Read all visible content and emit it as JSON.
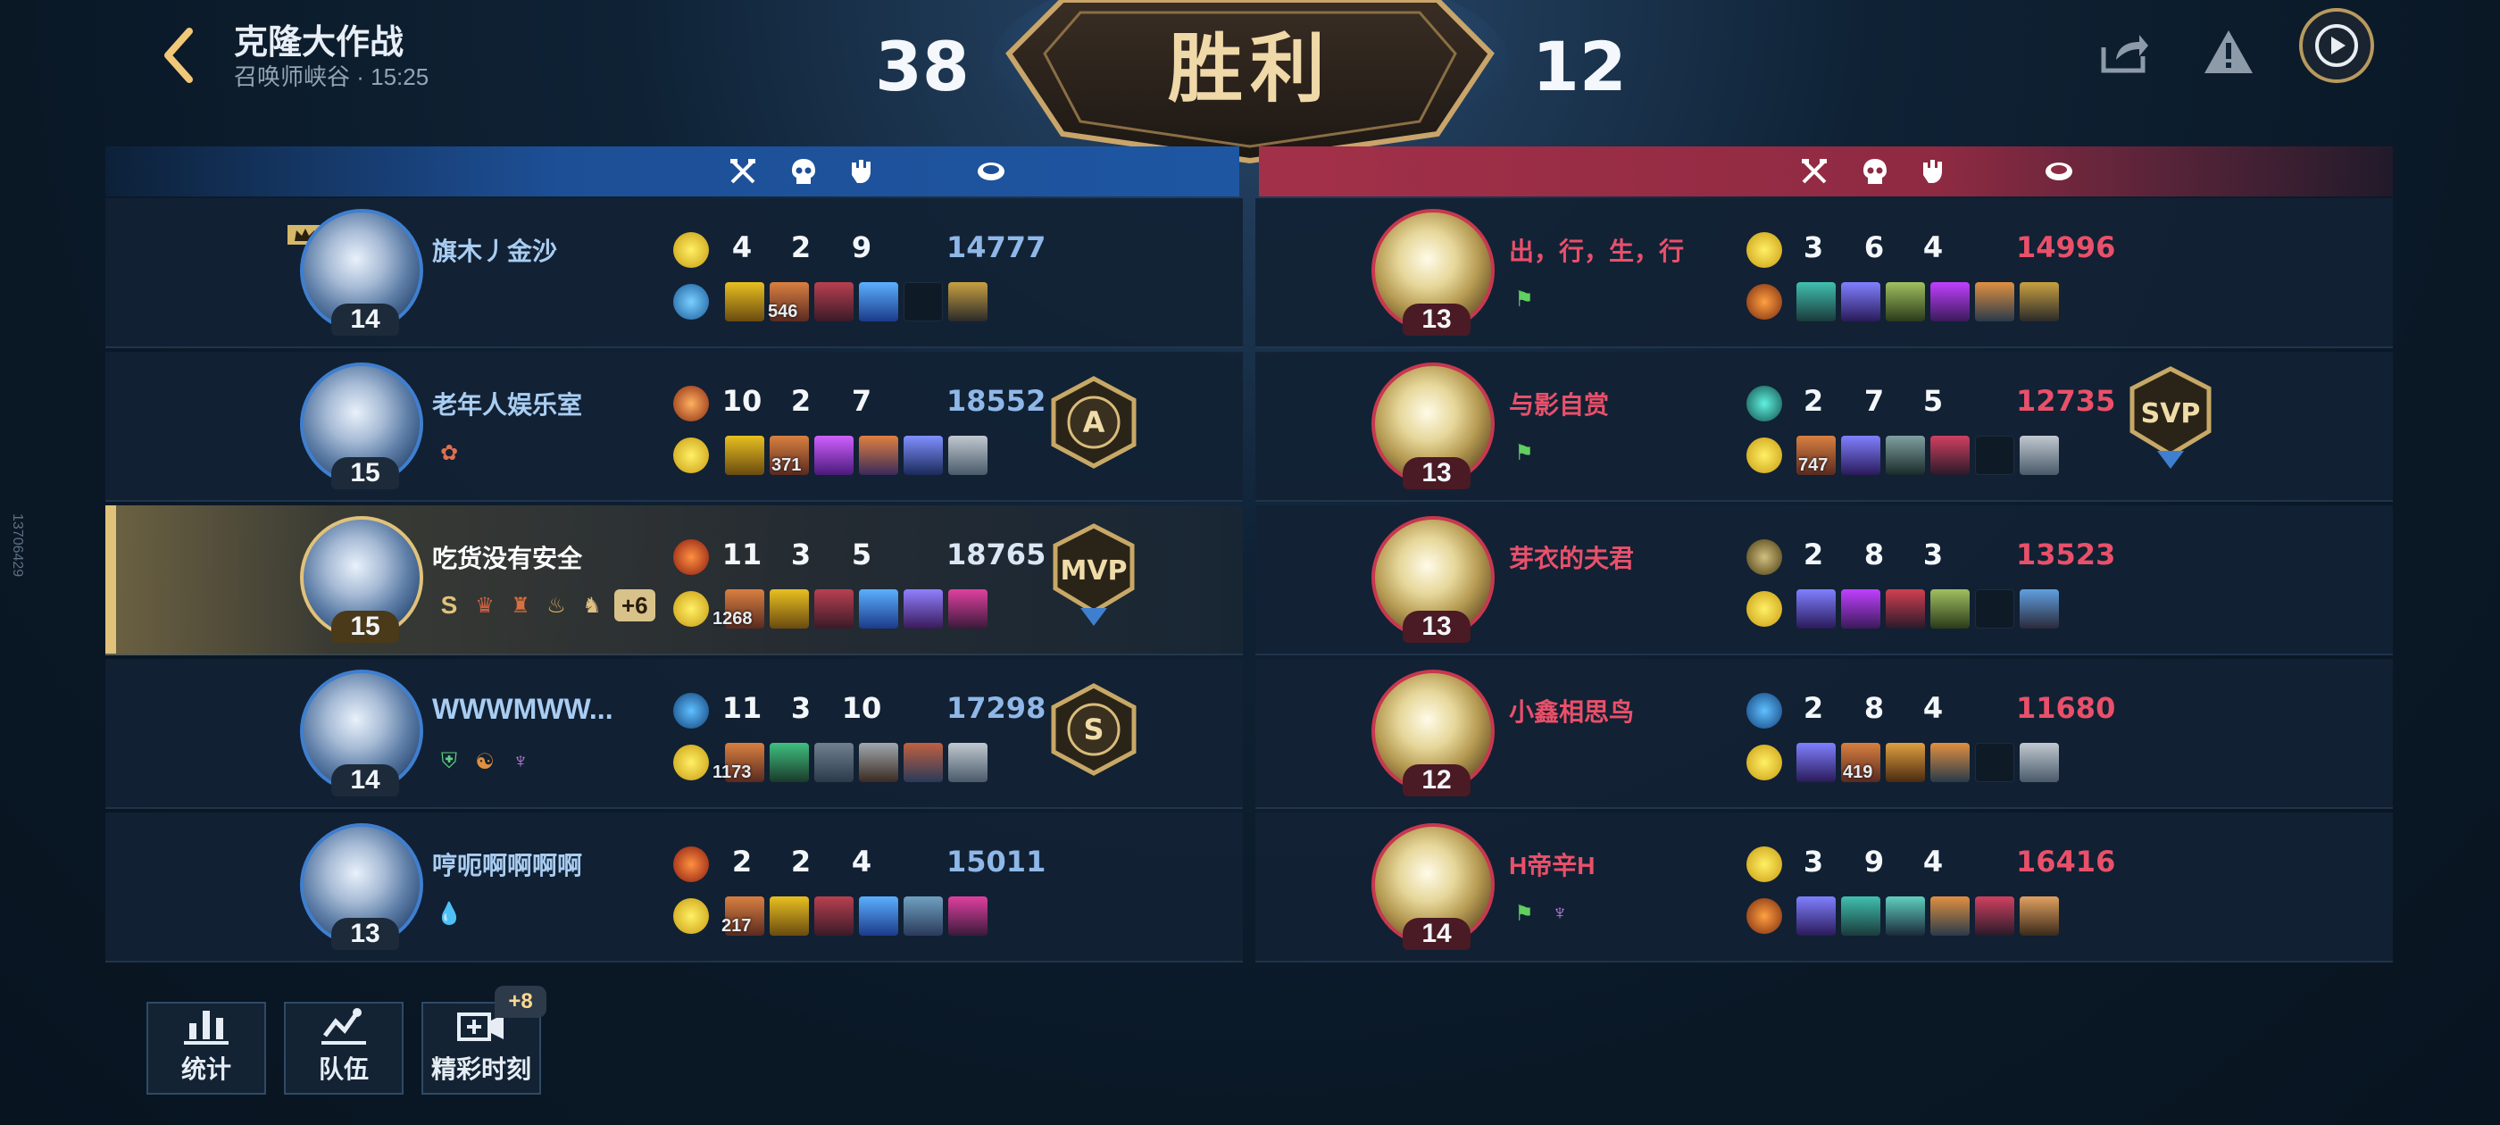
{
  "header": {
    "title": "克隆大作战",
    "subtitle": "召唤师峡谷 · 15:25",
    "score_blue": "38",
    "score_red": "12",
    "result": "胜利"
  },
  "side_id": "13706429",
  "columns": [
    "kills-icon",
    "deaths-icon",
    "assists-icon",
    "gold-icon"
  ],
  "blue_team": [
    {
      "name": "旗木丿金沙",
      "level": "14",
      "k": "4",
      "d": "2",
      "a": "9",
      "gold": "14777",
      "item_count": "546",
      "badge": "",
      "runes": [
        "crown"
      ]
    },
    {
      "name": "老年人娱乐室",
      "level": "15",
      "k": "10",
      "d": "2",
      "a": "7",
      "gold": "18552",
      "item_count": "371",
      "badge": "A",
      "runes": [
        "rose"
      ]
    },
    {
      "name": "吃货没有安全",
      "level": "15",
      "k": "11",
      "d": "3",
      "a": "5",
      "gold": "18765",
      "item_count": "1268",
      "badge": "MVP",
      "runes_extra": "+6",
      "s_label": "S"
    },
    {
      "name": "WWWMWW...",
      "level": "14",
      "k": "11",
      "d": "3",
      "a": "10",
      "gold": "17298",
      "item_count": "1173",
      "badge": "S"
    },
    {
      "name": "哼呃啊啊啊啊",
      "level": "13",
      "k": "2",
      "d": "2",
      "a": "4",
      "gold": "15011",
      "item_count": "217",
      "badge": ""
    }
  ],
  "red_team": [
    {
      "name": "出，行，生，行",
      "level": "13",
      "k": "3",
      "d": "6",
      "a": "4",
      "gold": "14996",
      "item_count": "",
      "badge": ""
    },
    {
      "name": "与影自赏",
      "level": "13",
      "k": "2",
      "d": "7",
      "a": "5",
      "gold": "12735",
      "item_count": "747",
      "badge": "SVP"
    },
    {
      "name": "芽衣的夫君",
      "level": "13",
      "k": "2",
      "d": "8",
      "a": "3",
      "gold": "13523",
      "item_count": "",
      "badge": ""
    },
    {
      "name": "小鑫相思鸟",
      "level": "12",
      "k": "2",
      "d": "8",
      "a": "4",
      "gold": "11680",
      "item_count": "419",
      "badge": ""
    },
    {
      "name": "H帝辛H",
      "level": "14",
      "k": "3",
      "d": "9",
      "a": "4",
      "gold": "16416",
      "item_count": "",
      "badge": ""
    }
  ],
  "bottom": {
    "stats_label": "统计",
    "team_label": "队伍",
    "highlights_label": "精彩时刻",
    "highlights_badge": "+8"
  },
  "colors": {
    "blue_accent": "#3f7fd0",
    "red_accent": "#c8384f",
    "gold_accent": "#e0c27a"
  }
}
